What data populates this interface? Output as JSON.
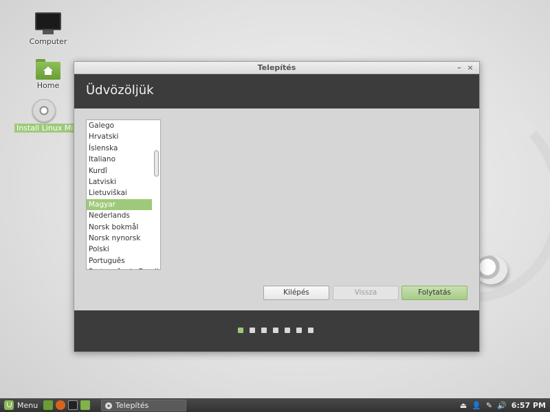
{
  "desktop": {
    "icons": [
      {
        "label": "Computer"
      },
      {
        "label": "Home"
      },
      {
        "label": "Install Linux Mint"
      }
    ]
  },
  "window": {
    "title": "Telepítés",
    "minimize": "–",
    "close": "×",
    "header": "Üdvözöljük",
    "languages": [
      "Galego",
      "Hrvatski",
      "Íslenska",
      "Italiano",
      "Kurdî",
      "Latviski",
      "Lietuviškai",
      "Magyar",
      "Nederlands",
      "Norsk bokmål",
      "Norsk nynorsk",
      "Polski",
      "Português",
      "Português do Brasil"
    ],
    "selected_language": "Magyar",
    "buttons": {
      "quit": "Kilépés",
      "back": "Vissza",
      "continue": "Folytatás"
    },
    "steps": {
      "total": 7,
      "current": 1
    }
  },
  "taskbar": {
    "menu_label": "Menu",
    "task_title": "Telepítés",
    "clock": "6:57 PM"
  },
  "colors": {
    "accent": "#9fc97a",
    "header_bg": "#3c3c3c"
  }
}
